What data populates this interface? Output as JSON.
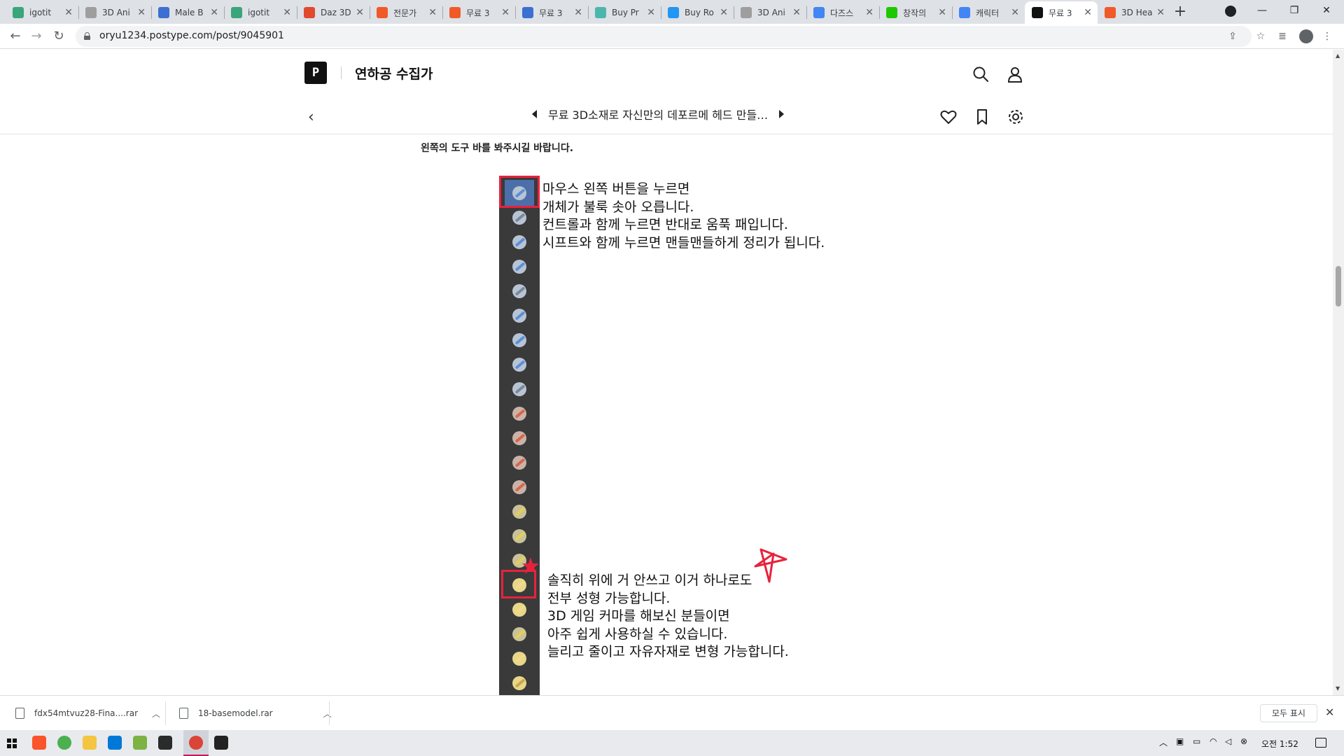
{
  "browser": {
    "tabs": [
      {
        "label": "igotit",
        "color": "#3aa57a"
      },
      {
        "label": "3D Ani",
        "color": "#9e9e9e"
      },
      {
        "label": "Male B",
        "color": "#3b6fd1"
      },
      {
        "label": "igotit",
        "color": "#3aa57a"
      },
      {
        "label": "Daz 3D",
        "color": "#e04a2f"
      },
      {
        "label": "전문가",
        "color": "#f05a28"
      },
      {
        "label": "무료 3",
        "color": "#f05a28"
      },
      {
        "label": "무료 3",
        "color": "#3b6fd1"
      },
      {
        "label": "Buy Pr",
        "color": "#4db6ac"
      },
      {
        "label": "Buy Ro",
        "color": "#2196f3"
      },
      {
        "label": "3D Ani",
        "color": "#9e9e9e"
      },
      {
        "label": "다즈스",
        "color": "#4285f4"
      },
      {
        "label": "창작의",
        "color": "#1ec800"
      },
      {
        "label": "캐릭터",
        "color": "#4285f4"
      },
      {
        "label": "무료 3",
        "color": "#111111",
        "active": true
      },
      {
        "label": "3D Hea",
        "color": "#f05a28"
      }
    ],
    "url": "oryu1234.postype.com/post/9045901"
  },
  "site": {
    "logo": "P",
    "name": "연하공 수집가",
    "post_title": "무료 3D소재로 자신만의 데포르메 헤드 만들…"
  },
  "content": {
    "intro": "왼쪽의 도구 바를 봐주시길 바랍니다.",
    "desc1": [
      "마우스 왼쪽 버튼을 누르면",
      "개체가 불룩 솟아 오릅니다.",
      "컨트롤과 함께 누르면 반대로 움푹 패입니다.",
      "시프트와 함께 누르면 맨들맨들하게 정리가 됩니다."
    ],
    "desc2": [
      "솔직히 위에 거 안쓰고 이거 하나로도",
      "전부 성형 가능합니다.",
      "3D 게임 커마를 해보신 분들이면",
      "아주 쉽게 사용하실 수 있습니다.",
      "늘리고 줄이고 자유자재로 변형 가능합니다."
    ],
    "tools": [
      {
        "ball": "#b8c4d4",
        "stroke": "#5b8fd6"
      },
      {
        "ball": "#b8c4d4",
        "stroke": "#7a8899"
      },
      {
        "ball": "#b8c4d4",
        "stroke": "#5b8fd6"
      },
      {
        "ball": "#b8c4d4",
        "stroke": "#5b8fd6"
      },
      {
        "ball": "#b8c4d4",
        "stroke": "#7a8899"
      },
      {
        "ball": "#b8c4d4",
        "stroke": "#5b8fd6"
      },
      {
        "ball": "#b8c4d4",
        "stroke": "#5b8fd6"
      },
      {
        "ball": "#b8c4d4",
        "stroke": "#5b8fd6"
      },
      {
        "ball": "#b8c4d4",
        "stroke": "#7a8899"
      },
      {
        "ball": "#c9b3a9",
        "stroke": "#d9654a"
      },
      {
        "ball": "#c9b3a9",
        "stroke": "#d9654a"
      },
      {
        "ball": "#c9b3a9",
        "stroke": "#d9654a"
      },
      {
        "ball": "#c9b3a9",
        "stroke": "#d9654a"
      },
      {
        "ball": "#c8c29a",
        "stroke": "#e8cf52"
      },
      {
        "ball": "#c8c29a",
        "stroke": "#e8cf52"
      },
      {
        "ball": "#c8c29a",
        "stroke": "#e8cf52"
      },
      {
        "ball": "#e8d68a",
        "stroke": "#f0dc88"
      },
      {
        "ball": "#e8d68a",
        "stroke": "#f0dc88"
      },
      {
        "ball": "#c8c29a",
        "stroke": "#e8cf52"
      },
      {
        "ball": "#e8d68a",
        "stroke": "#f0dc88"
      },
      {
        "ball": "#e8d68a",
        "stroke": "#c8a84a"
      }
    ],
    "highlight_color": "#e8223c"
  },
  "downloads": [
    {
      "name": "fdx54mtvuz28-Fina....rar"
    },
    {
      "name": "18-basemodel.rar"
    }
  ],
  "downloads_show_all": "모두 표시",
  "taskbar": {
    "apps": [
      {
        "name": "brave",
        "color": "#fb542b"
      },
      {
        "name": "chrome",
        "color": "#4caf50"
      },
      {
        "name": "file-explorer",
        "color": "#f4c542"
      },
      {
        "name": "vscode",
        "color": "#0078d7"
      },
      {
        "name": "notepad",
        "color": "#7cb342"
      },
      {
        "name": "terminal",
        "color": "#2b2b2b"
      },
      {
        "name": "chrome-active",
        "color": "#db4437"
      },
      {
        "name": "app-black",
        "color": "#222222"
      }
    ],
    "clock": "오전 1:52"
  }
}
